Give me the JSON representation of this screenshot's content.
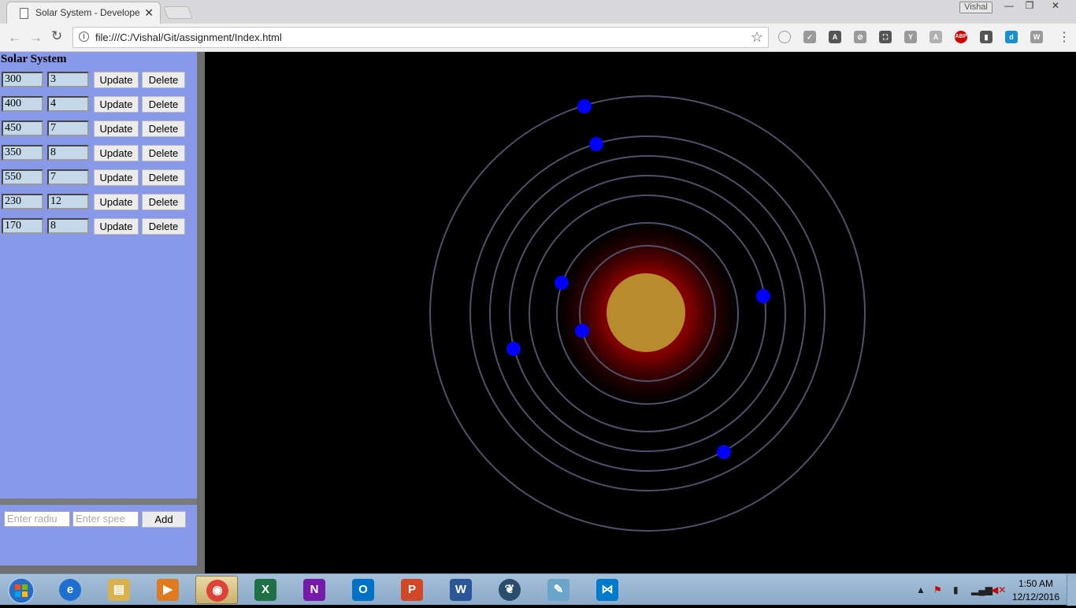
{
  "browser": {
    "tab_title": "Solar System - Develope",
    "tab_close": "✕",
    "profile_name": "Vishal",
    "url": "file:///C:/Vishal/Git/assignment/Index.html",
    "window_controls": {
      "minimize": "—",
      "restore": "❐",
      "close": "✕"
    },
    "extensions": [
      {
        "name": "circle-icon",
        "label": "",
        "color": "#9a9a9a"
      },
      {
        "name": "check-icon",
        "label": "✓",
        "color": "#9a9a9a"
      },
      {
        "name": "angular-icon",
        "label": "A",
        "color": "#555555"
      },
      {
        "name": "eye-off-icon",
        "label": "⊘",
        "color": "#9a9a9a"
      },
      {
        "name": "screenshot-icon",
        "label": "⛶",
        "color": "#555555"
      },
      {
        "name": "y-icon",
        "label": "Y",
        "color": "#9a9a9a"
      },
      {
        "name": "angular-grey-icon",
        "label": "A",
        "color": "#b0b0b0"
      },
      {
        "name": "adblock-icon",
        "label": "ABP",
        "color": "#d40000"
      },
      {
        "name": "notes-icon",
        "label": "▮",
        "color": "#555555"
      },
      {
        "name": "d-icon",
        "label": "d",
        "color": "#1a8fc9"
      },
      {
        "name": "w-icon",
        "label": "W",
        "color": "#9a9a9a"
      }
    ]
  },
  "sidebar": {
    "heading": "Solar System",
    "planets": [
      {
        "radius": "300",
        "speed": "3"
      },
      {
        "radius": "400",
        "speed": "4"
      },
      {
        "radius": "450",
        "speed": "7"
      },
      {
        "radius": "350",
        "speed": "8"
      },
      {
        "radius": "550",
        "speed": "7"
      },
      {
        "radius": "230",
        "speed": "12"
      },
      {
        "radius": "170",
        "speed": "8"
      }
    ],
    "update_label": "Update",
    "delete_label": "Delete",
    "add": {
      "radius_placeholder": "Enter radiu",
      "speed_placeholder": "Enter spee",
      "button_label": "Add"
    }
  },
  "scene": {
    "sun_color": "#b88c2c",
    "glow_color": "#9a0000",
    "orbit_color": "#50506a",
    "planet_color": "#0000ff",
    "background": "#000000"
  },
  "taskbar": {
    "apps": [
      {
        "name": "internet-explorer-icon",
        "label": "e",
        "color": "#1f6fd0",
        "active": false
      },
      {
        "name": "file-explorer-icon",
        "label": "▤",
        "color": "#d9b24c",
        "active": false
      },
      {
        "name": "media-player-icon",
        "label": "▶",
        "color": "#e07a1f",
        "active": false
      },
      {
        "name": "chrome-icon",
        "label": "◉",
        "color": "#db4437",
        "active": true
      },
      {
        "name": "excel-icon",
        "label": "X",
        "color": "#1e7145",
        "active": false
      },
      {
        "name": "onenote-icon",
        "label": "N",
        "color": "#7719aa",
        "active": false
      },
      {
        "name": "outlook-icon",
        "label": "O",
        "color": "#0072c6",
        "active": false
      },
      {
        "name": "powerpoint-icon",
        "label": "P",
        "color": "#d24726",
        "active": false
      },
      {
        "name": "word-icon",
        "label": "W",
        "color": "#2b579a",
        "active": false
      },
      {
        "name": "app-tree-icon",
        "label": "❦",
        "color": "#2a4d6e",
        "active": false
      },
      {
        "name": "notepad-icon",
        "label": "✎",
        "color": "#6aa5c9",
        "active": false
      },
      {
        "name": "vscode-icon",
        "label": "⋈",
        "color": "#007acc",
        "active": false
      }
    ],
    "clock_time": "1:50 AM",
    "clock_date": "12/12/2016"
  }
}
